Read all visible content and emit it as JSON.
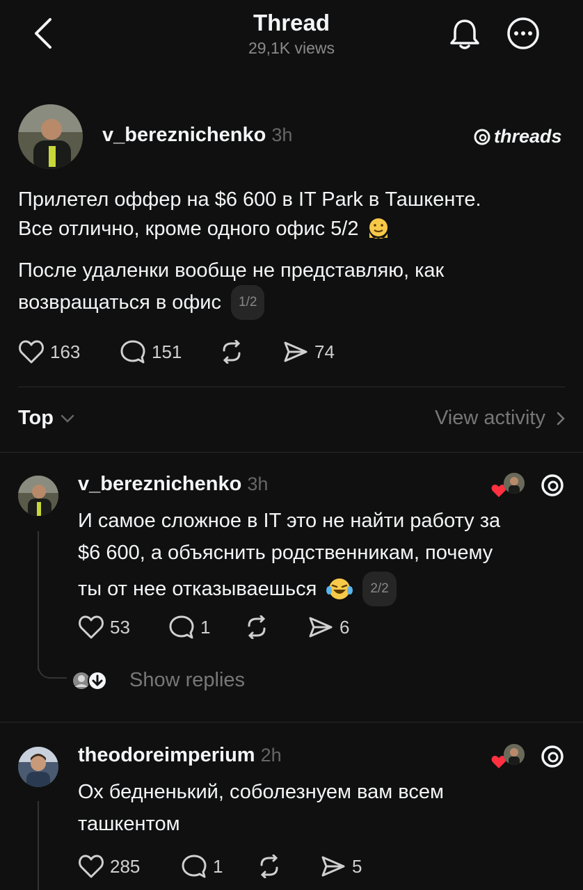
{
  "header": {
    "title": "Thread",
    "views": "29,1K views"
  },
  "post": {
    "username": "v_bereznichenko",
    "time": "3h",
    "brand": "threads",
    "text_line1": "Прилетел оффер на $6 600 в IT Park в Ташкенте.",
    "text_line2": "Все отлично, кроме одного офис 5/2",
    "text_line3": "После удаленки вообще не представляю, как",
    "text_line4": "возвращаться в офис",
    "page_indicator": "1/2",
    "likes": "163",
    "comments": "151",
    "shares": "74"
  },
  "sort": {
    "label": "Top",
    "view_activity": "View activity"
  },
  "replies": [
    {
      "username": "v_bereznichenko",
      "time": "3h",
      "line1": "И самое сложное в IT это не найти работу за",
      "line2": "$6 600, а объяснить родственникам, почему",
      "line3": "ты от нее отказываешься",
      "page_indicator": "2/2",
      "likes": "53",
      "comments": "1",
      "shares": "6",
      "show_replies": "Show replies"
    },
    {
      "username": "theodoreimperium",
      "time": "2h",
      "line1": "Ох бедненький, соболезнуем вам всем",
      "line2": "ташкентом",
      "likes": "285",
      "comments": "1",
      "shares": "5"
    }
  ],
  "icons": {
    "back": "chevron-left-icon",
    "bell": "bell-icon",
    "more": "more-circle-icon",
    "like": "heart-icon",
    "comment": "comment-icon",
    "repost": "repost-icon",
    "share": "send-icon",
    "threads_logo": "threads-logo-icon",
    "red_heart": "red-heart-icon",
    "emoji_melting": "melting-face-emoji",
    "emoji_laugh": "laughing-emoji"
  },
  "colors": {
    "background": "#101010",
    "text": "#f3f5f7",
    "muted": "#777777",
    "heart_red": "#ff3040"
  }
}
